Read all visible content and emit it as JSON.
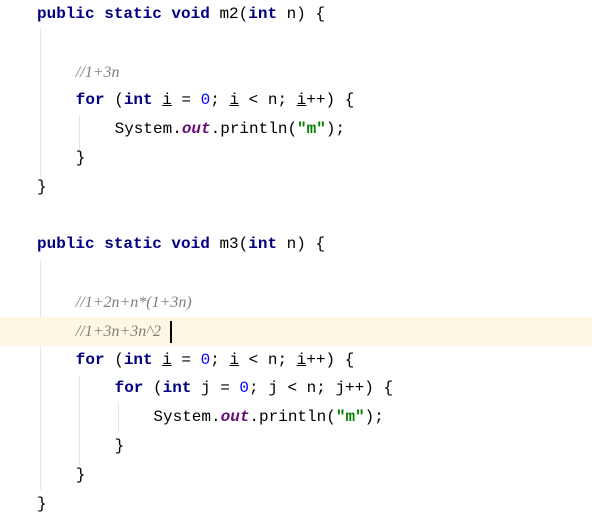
{
  "editor": {
    "colors": {
      "keyword": "#000080",
      "number": "#0000ff",
      "string": "#008000",
      "comment": "#808080",
      "field": "#660e7a",
      "current_line": "#fdf7e3"
    },
    "current_line_index": 11,
    "lines": [
      {
        "indent": 0,
        "tokens": [
          [
            "kw",
            "public static void "
          ],
          [
            "plain",
            "m2("
          ],
          [
            "kw",
            "int"
          ],
          [
            "plain",
            " n) {"
          ]
        ]
      },
      {
        "indent": 0,
        "tokens": []
      },
      {
        "indent": 1,
        "tokens": [
          [
            "cm",
            "//1+3n"
          ]
        ]
      },
      {
        "indent": 1,
        "tokens": [
          [
            "kw",
            "for"
          ],
          [
            "plain",
            " ("
          ],
          [
            "kw",
            "int "
          ],
          [
            "ul",
            "i"
          ],
          [
            "plain",
            " = "
          ],
          [
            "num",
            "0"
          ],
          [
            "plain",
            "; "
          ],
          [
            "ul",
            "i"
          ],
          [
            "plain",
            " < n; "
          ],
          [
            "ul",
            "i"
          ],
          [
            "plain",
            "++) {"
          ]
        ]
      },
      {
        "indent": 2,
        "tokens": [
          [
            "plain",
            "System."
          ],
          [
            "field",
            "out"
          ],
          [
            "plain",
            ".println("
          ],
          [
            "str",
            "\"m\""
          ],
          [
            "plain",
            ");"
          ]
        ]
      },
      {
        "indent": 1,
        "tokens": [
          [
            "plain",
            "}"
          ]
        ]
      },
      {
        "indent": 0,
        "tokens": [
          [
            "plain",
            "}"
          ]
        ]
      },
      {
        "indent": 0,
        "tokens": []
      },
      {
        "indent": 0,
        "tokens": [
          [
            "kw",
            "public static void "
          ],
          [
            "plain",
            "m3("
          ],
          [
            "kw",
            "int"
          ],
          [
            "plain",
            " n) {"
          ]
        ]
      },
      {
        "indent": 0,
        "tokens": []
      },
      {
        "indent": 1,
        "tokens": [
          [
            "cm",
            "//1+2n+n*(1+3n)"
          ]
        ]
      },
      {
        "indent": 1,
        "tokens": [
          [
            "cm",
            "//1+3n+3n^2"
          ]
        ]
      },
      {
        "indent": 1,
        "tokens": [
          [
            "kw",
            "for"
          ],
          [
            "plain",
            " ("
          ],
          [
            "kw",
            "int "
          ],
          [
            "ul",
            "i"
          ],
          [
            "plain",
            " = "
          ],
          [
            "num",
            "0"
          ],
          [
            "plain",
            "; "
          ],
          [
            "ul",
            "i"
          ],
          [
            "plain",
            " < n; "
          ],
          [
            "ul",
            "i"
          ],
          [
            "plain",
            "++) {"
          ]
        ]
      },
      {
        "indent": 2,
        "tokens": [
          [
            "kw",
            "for"
          ],
          [
            "plain",
            " ("
          ],
          [
            "kw",
            "int "
          ],
          [
            "plain",
            "j = "
          ],
          [
            "num",
            "0"
          ],
          [
            "plain",
            "; j < n; j++) {"
          ]
        ]
      },
      {
        "indent": 3,
        "tokens": [
          [
            "plain",
            "System."
          ],
          [
            "field",
            "out"
          ],
          [
            "plain",
            ".println("
          ],
          [
            "str",
            "\"m\""
          ],
          [
            "plain",
            ");"
          ]
        ]
      },
      {
        "indent": 2,
        "tokens": [
          [
            "plain",
            "}"
          ]
        ]
      },
      {
        "indent": 1,
        "tokens": [
          [
            "plain",
            "}"
          ]
        ]
      },
      {
        "indent": 0,
        "tokens": [
          [
            "plain",
            "}"
          ]
        ]
      }
    ]
  }
}
